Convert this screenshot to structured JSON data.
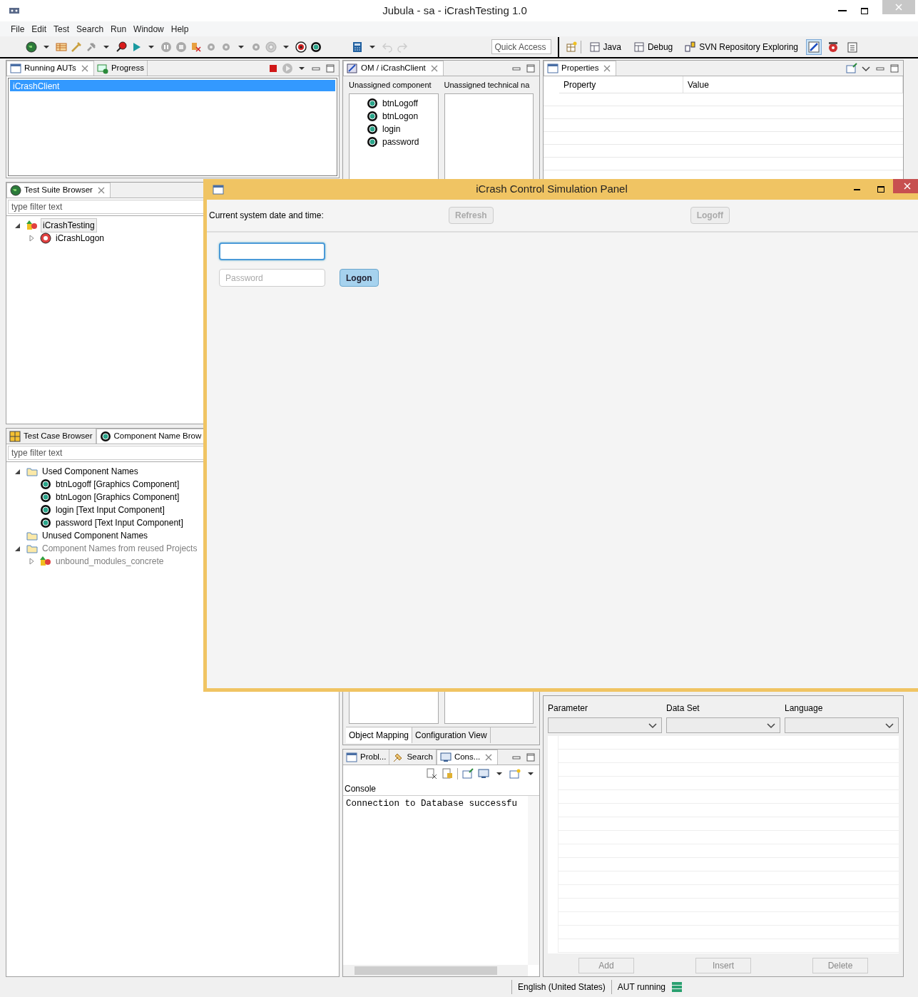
{
  "window": {
    "title": "Jubula - sa - iCrashTesting 1.0"
  },
  "menu": [
    "File",
    "Edit",
    "Test",
    "Search",
    "Run",
    "Window",
    "Help"
  ],
  "toolbar": {
    "quick_access": {
      "placeholder": "Quick Access"
    },
    "perspectives": [
      {
        "label": "Java"
      },
      {
        "label": "Debug"
      },
      {
        "label": "SVN Repository Exploring"
      }
    ],
    "icon_perspectives": [
      {
        "selected": true
      },
      {
        "selected": false
      },
      {
        "selected": false
      }
    ]
  },
  "running_auts": {
    "tabs": [
      {
        "label": "Running AUTs",
        "selected": true
      },
      {
        "label": "Progress",
        "selected": false
      }
    ],
    "items": [
      {
        "label": "iCrashClient",
        "selected": true
      }
    ]
  },
  "object_mapping": {
    "tab": "OM / iCrashClient",
    "columns": [
      "Unassigned component",
      "Unassigned technical na"
    ],
    "components": [
      "btnLogoff",
      "btnLogon",
      "login",
      "password"
    ],
    "bottom_tabs": [
      {
        "label": "Object Mapping",
        "selected": true
      },
      {
        "label": "Configuration View",
        "selected": false
      }
    ]
  },
  "properties": {
    "tab": "Properties",
    "columns": [
      "Property",
      "Value"
    ]
  },
  "test_suite_browser": {
    "tab": "Test Suite Browser",
    "filter": {
      "placeholder": "type filter text"
    },
    "tree": [
      {
        "label": "iCrashTesting",
        "kind": "project",
        "expanded": true,
        "selected": true,
        "disabled": false,
        "children": [
          {
            "label": "iCrashLogon",
            "kind": "suite",
            "expanded": false,
            "selected": false,
            "disabled": false
          }
        ]
      }
    ]
  },
  "test_case_browser": {
    "tabs": [
      {
        "label": "Test Case Browser",
        "selected": false
      },
      {
        "label": "Component Name Brow",
        "selected": true
      }
    ],
    "filter": {
      "placeholder": "type filter text"
    },
    "tree": [
      {
        "label": "Used Component Names",
        "kind": "folder",
        "expanded": true,
        "selected": false,
        "disabled": false,
        "children": [
          {
            "label": "btnLogoff [Graphics Component]",
            "kind": "component",
            "selected": false,
            "disabled": false
          },
          {
            "label": "btnLogon [Graphics Component]",
            "kind": "component",
            "selected": false,
            "disabled": false
          },
          {
            "label": "login [Text Input Component]",
            "kind": "component",
            "selected": false,
            "disabled": false
          },
          {
            "label": "password [Text Input Component]",
            "kind": "component",
            "selected": false,
            "disabled": false
          }
        ]
      },
      {
        "label": "Unused Component Names",
        "kind": "folder",
        "selected": false,
        "disabled": false
      },
      {
        "label": "Component Names from reused Projects",
        "kind": "folder",
        "expanded": true,
        "selected": false,
        "disabled": true,
        "children": [
          {
            "label": "unbound_modules_concrete",
            "kind": "project",
            "expanded": false,
            "selected": false,
            "disabled": true
          }
        ]
      }
    ]
  },
  "console": {
    "tabs": [
      {
        "label": "Probl...",
        "selected": false
      },
      {
        "label": "Search",
        "selected": false
      },
      {
        "label": "Cons...",
        "selected": true
      }
    ],
    "title": "Console",
    "lines": [
      "Connection to Database successfu"
    ]
  },
  "data_sets": {
    "columns": [
      "Parameter",
      "Data Set",
      "Language"
    ],
    "buttons": [
      {
        "label": "Add",
        "disabled": true
      },
      {
        "label": "Insert",
        "disabled": true
      },
      {
        "label": "Delete",
        "disabled": true
      }
    ]
  },
  "status_bar": {
    "locale": "English (United States)",
    "aut_status": "AUT running"
  },
  "dialog": {
    "title": "iCrash Control Simulation Panel",
    "date_label": "Current system date and time:",
    "buttons": [
      {
        "label": "Refresh",
        "disabled": true
      },
      {
        "label": "Logoff",
        "disabled": true
      }
    ],
    "login_field": {
      "focused": true
    },
    "password_field": {
      "placeholder": "Password"
    },
    "logon_button": "Logon"
  }
}
